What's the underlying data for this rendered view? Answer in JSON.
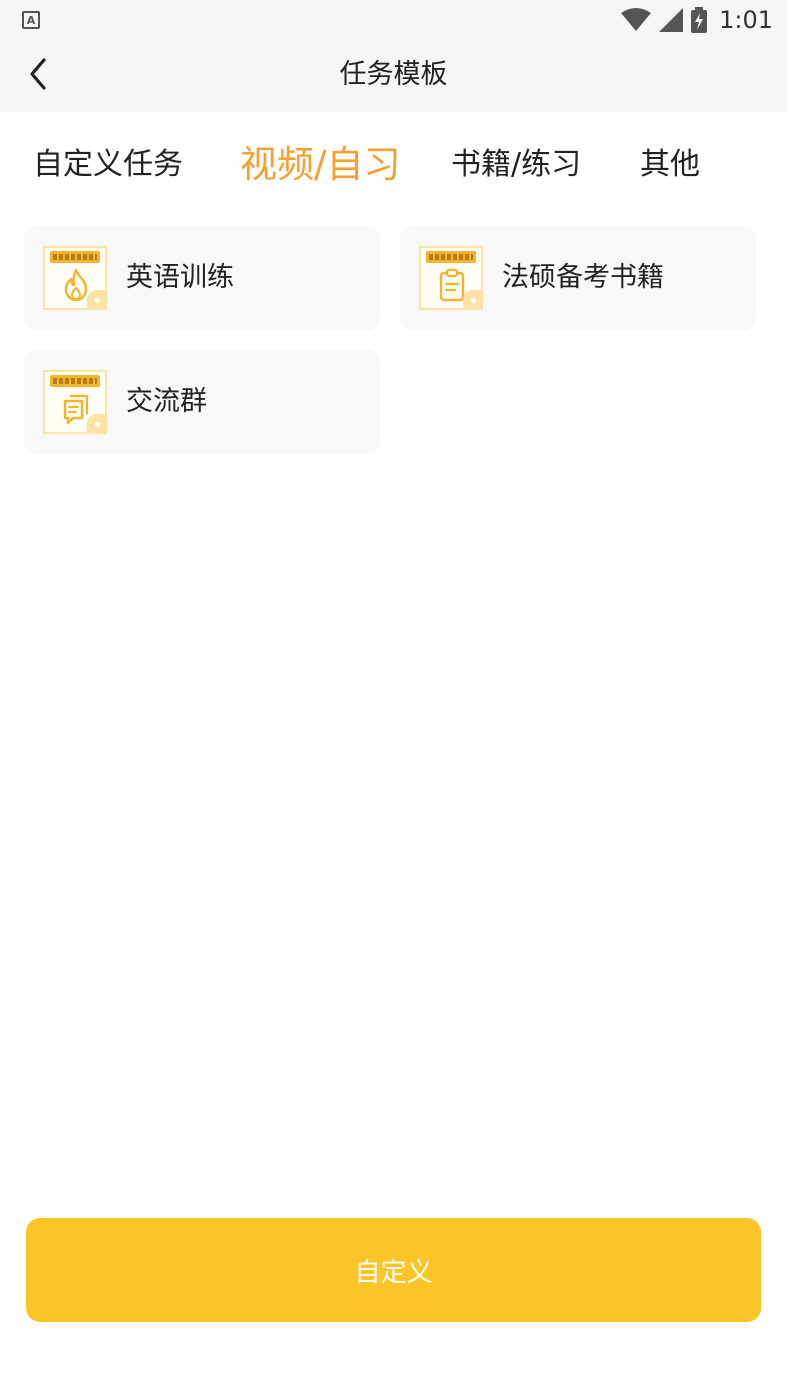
{
  "status_bar": {
    "left_icon": "A",
    "icons": [
      "wifi-icon",
      "signal-icon",
      "battery-charging-icon"
    ],
    "time": "1:01"
  },
  "header": {
    "back_icon": "chevron-left-icon",
    "title": "任务模板"
  },
  "tabs": [
    {
      "label": "自定义任务",
      "active": false
    },
    {
      "label": "视频/自习",
      "active": true
    },
    {
      "label": "书籍/练习",
      "active": false
    },
    {
      "label": "其他",
      "active": false
    }
  ],
  "colors": {
    "accent": "#f5a030",
    "button": "#fbc528",
    "card_bg": "#f8f8f8",
    "header_bg": "#f6f6f6"
  },
  "templates": [
    {
      "label": "英语训练",
      "icon": "flame-icon"
    },
    {
      "label": "法硕备考书籍",
      "icon": "clipboard-icon"
    },
    {
      "label": "交流群",
      "icon": "chat-icon"
    }
  ],
  "footer": {
    "button_label": "自定义"
  }
}
